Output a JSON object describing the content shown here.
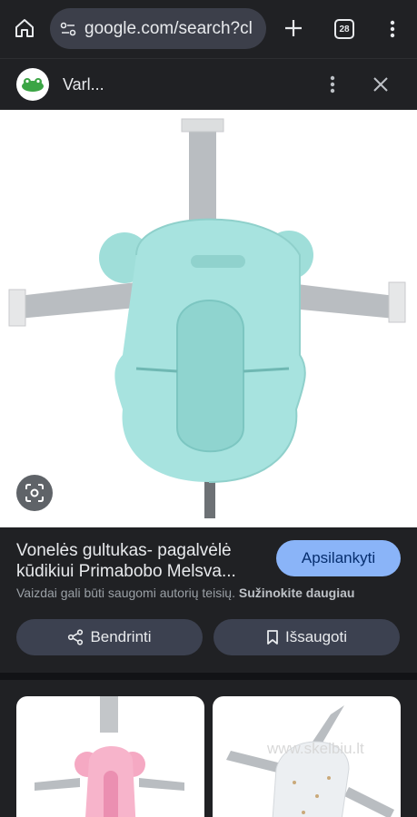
{
  "browser": {
    "url": "google.com/search?cl",
    "tab_count": "28"
  },
  "result_header": {
    "site_name": "Varl..."
  },
  "info": {
    "title": "Vonelės gultukas- pagalvėlė kūdikiui Primabobo Melsva...",
    "visit_label": "Apsilankyti",
    "copyright_notice": "Vaizdai gali būti saugomi autorių teisių.",
    "learn_more": "Sužinokite daugiau",
    "share_label": "Bendrinti",
    "save_label": "Išsaugoti"
  },
  "related": {
    "watermark": "www.skelbiu.lt"
  },
  "colors": {
    "accent": "#8ab4f8",
    "background": "#202124",
    "button_bg": "#3c4150",
    "product_color": "#a7e3df"
  }
}
